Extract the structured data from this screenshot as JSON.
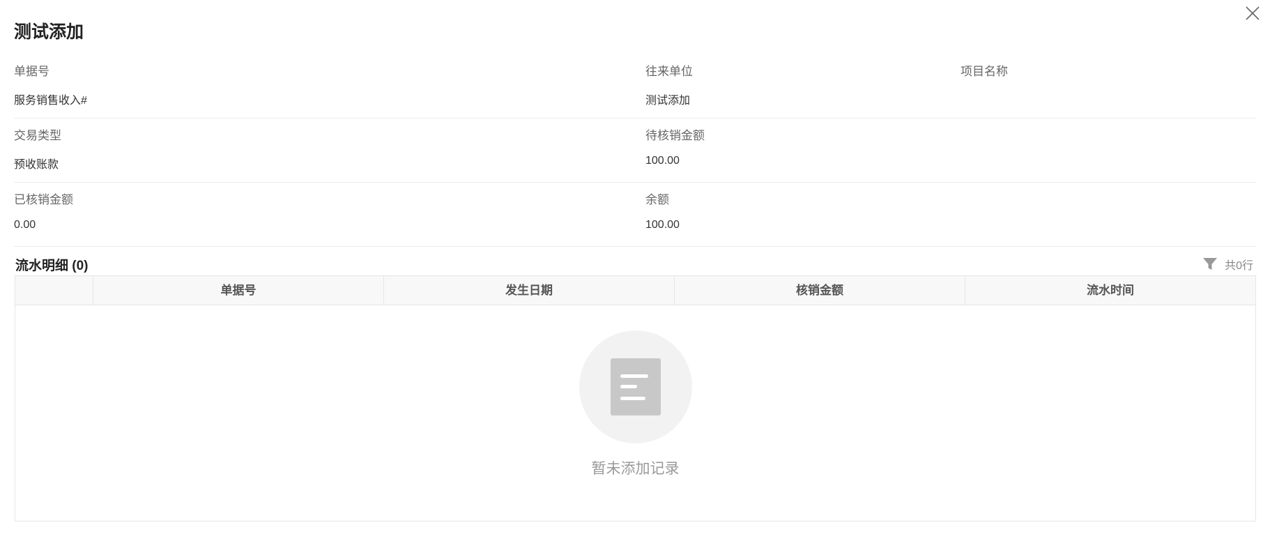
{
  "dialog": {
    "title": "测试添加"
  },
  "fields": {
    "doc_no": {
      "label": "单据号",
      "value": "服务销售收入#"
    },
    "counterparty": {
      "label": "往来单位",
      "value": "测试添加"
    },
    "project_name": {
      "label": "项目名称",
      "value": ""
    },
    "transaction_type": {
      "label": "交易类型",
      "value": "预收账款"
    },
    "pending_writeoff": {
      "label": "待核销金额",
      "value": "100.00"
    },
    "written_off": {
      "label": "已核销金额",
      "value": "0.00"
    },
    "balance": {
      "label": "余额",
      "value": "100.00"
    }
  },
  "flow_section": {
    "title": "流水明细 (0)",
    "row_count": "共0行",
    "columns": [
      "单据号",
      "发生日期",
      "核销金额",
      "流水时间"
    ],
    "rows": [],
    "empty_text": "暂未添加记录"
  },
  "icons": {
    "close": "close-icon",
    "filter": "filter-icon",
    "empty": "document-icon"
  }
}
